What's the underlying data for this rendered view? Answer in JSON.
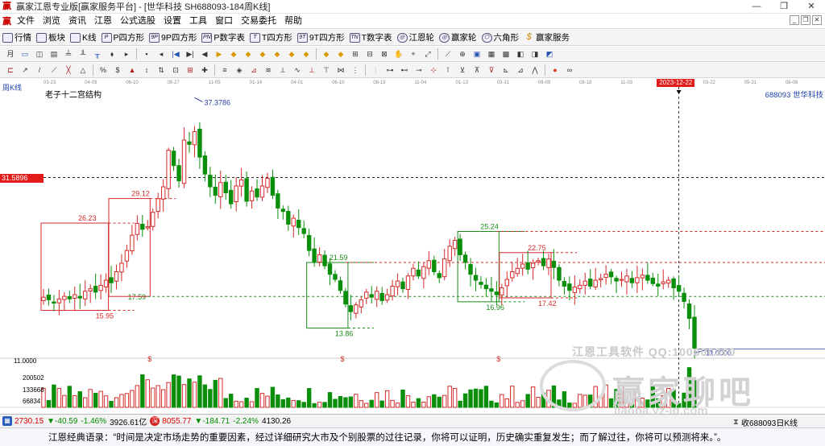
{
  "window": {
    "title": "赢家江恩专业版[赢家服务平台] - [世华科技  SH688093-184周K线]",
    "logo": "赢",
    "buttons": [
      "—",
      "❐",
      "✕"
    ]
  },
  "menu": {
    "logo": "赢",
    "items": [
      "文件",
      "浏览",
      "资讯",
      "江恩",
      "公式选股",
      "设置",
      "工具",
      "窗口",
      "交易委托",
      "帮助"
    ],
    "mdi_buttons": [
      "_",
      "❐",
      "✕"
    ]
  },
  "toolbar1": [
    {
      "icon": "grid-icon",
      "label": "行情"
    },
    {
      "icon": "blocks-icon",
      "label": "板块"
    },
    {
      "icon": "kline-icon",
      "label": "K线"
    },
    {
      "icon": "p-icon",
      "label": "P四方形"
    },
    {
      "icon": "9p-icon",
      "label": "9P四方形"
    },
    {
      "icon": "pn-icon",
      "label": "P数字表"
    },
    {
      "icon": "t-icon",
      "label": "T四方形"
    },
    {
      "icon": "9t-icon",
      "label": "9T四方形"
    },
    {
      "icon": "tn-icon",
      "label": "T数字表"
    },
    {
      "icon": "wheel-icon",
      "label": "江恩轮"
    },
    {
      "icon": "wheel2-icon",
      "label": "赢家轮"
    },
    {
      "icon": "hexagon-icon",
      "label": "六角形"
    },
    {
      "icon": "dollar-icon",
      "label": "赢家服务"
    }
  ],
  "toolbar2": {
    "prefix": "月",
    "count": 36
  },
  "toolbar3": {
    "count": 38
  },
  "dates": [
    "03-23",
    "04-09",
    "06-10",
    "08-27",
    "11-05",
    "01-14",
    "04-01",
    "06-10",
    "08-19",
    "11-04",
    "01-13",
    "03-31",
    "06-09",
    "08-18",
    "11-03",
    "2023-12-22",
    "03-22",
    "05-31",
    "08-08"
  ],
  "period_label": "周K线",
  "indicator_name": "老子十二宫结构",
  "stock": {
    "code": "688093",
    "name": "世华科技",
    "code_label": "688093  世华科技"
  },
  "price_tag": "31.5896",
  "date_tag": "2023-12-22",
  "vol_labels": {
    "top": "11.0000",
    "l1": "200502",
    "l2": "133668",
    "l3": "66834"
  },
  "watermark": {
    "tool": "江恩工具软件  QQ:100800360",
    "forum": "赢家聊吧",
    "url": "liaoba.yz-jq.com"
  },
  "status": {
    "sh": {
      "price": "2730.15",
      "chg": "▼-40.59",
      "pct": "-1.46%",
      "amt": "3926.61亿"
    },
    "sz": {
      "price": "8055.77",
      "chg": "▼-184.71",
      "pct": "-2.24%",
      "amt": "4130.26"
    },
    "right_label": "收688093日K线"
  },
  "quote": "江恩经典语录：“时间是决定市场走势的重要因素，经过详细研究大市及个别股票的过往记录，你将可以证明，历史确实重复发生；而了解过往，你将可以预测将来。”。",
  "chart_data": {
    "type": "candlestick",
    "title": "世华科技 688093 周K线",
    "price_range": [
      10.5,
      41.5
    ],
    "vol_max": 270000,
    "boxes": [
      {
        "x0": 0,
        "x1": 12,
        "low": 15.95,
        "high": 26.23,
        "color": "#d42a2a",
        "label_hi": "26.23",
        "label_lo": "15.95",
        "dash_label": "17.59"
      },
      {
        "x0": 13,
        "x1": 20,
        "low": 17.59,
        "high": 29.12,
        "color": "#d42a2a",
        "label_hi": "29.12"
      },
      {
        "x0": 51,
        "x1": 58,
        "low": 13.86,
        "high": 21.59,
        "color": "#1a8a1a",
        "label_hi": "21.59",
        "label_lo": "13.86"
      },
      {
        "x0": 80,
        "x1": 87,
        "low": 16.96,
        "high": 25.24,
        "color": "#1a8a1a",
        "label_hi": "25.24",
        "label_lo": "16.96"
      },
      {
        "x0": 88,
        "x1": 97,
        "low": 17.42,
        "high": 22.75,
        "color": "#d42a2a",
        "label_hi": "22.75",
        "label_lo": "17.42"
      }
    ],
    "peak": "37.3786",
    "last_low": "11.0000",
    "cursor_price": 31.5896,
    "dollar_marks": [
      "$",
      "$",
      "$"
    ],
    "series": [
      17.5,
      17.2,
      16.8,
      17.3,
      17.6,
      17.3,
      17.8,
      17.4,
      18.2,
      18.5,
      18.1,
      18.9,
      19.5,
      19.2,
      20.5,
      21.5,
      23.0,
      24.8,
      26.2,
      25.5,
      25.8,
      27.5,
      29.1,
      30.5,
      34.8,
      33.0,
      31.2,
      36.0,
      35.5,
      37.0,
      34.0,
      32.0,
      30.5,
      29.5,
      31.0,
      29.8,
      28.5,
      30.6,
      31.3,
      28.8,
      30.0,
      29.3,
      30.6,
      31.5,
      29.5,
      28.0,
      27.6,
      26.1,
      26.8,
      25.7,
      25.0,
      23.0,
      21.6,
      22.5,
      21.2,
      20.2,
      19.6,
      18.3,
      16.7,
      15.8,
      16.6,
      17.2,
      18.1,
      17.5,
      18.2,
      17.1,
      17.8,
      18.8,
      19.4,
      18.5,
      20.0,
      20.9,
      20.0,
      21.1,
      21.8,
      20.5,
      19.8,
      22.0,
      23.5,
      24.2,
      22.5,
      21.6,
      20.2,
      19.5,
      19.0,
      18.5,
      18.2,
      17.8,
      18.6,
      19.6,
      20.5,
      20.9,
      21.4,
      20.8,
      21.5,
      21.8,
      21.2,
      22.0,
      21.0,
      19.5,
      18.8,
      18.3,
      18.7,
      18.9,
      19.4,
      18.8,
      19.5,
      19.7,
      20.2,
      19.9,
      19.4,
      19.6,
      20.0,
      19.2,
      19.8,
      20.1,
      19.5,
      19.1,
      18.8,
      19.3,
      19.5,
      18.6,
      18.2,
      17.0,
      15.0,
      11.5
    ]
  }
}
